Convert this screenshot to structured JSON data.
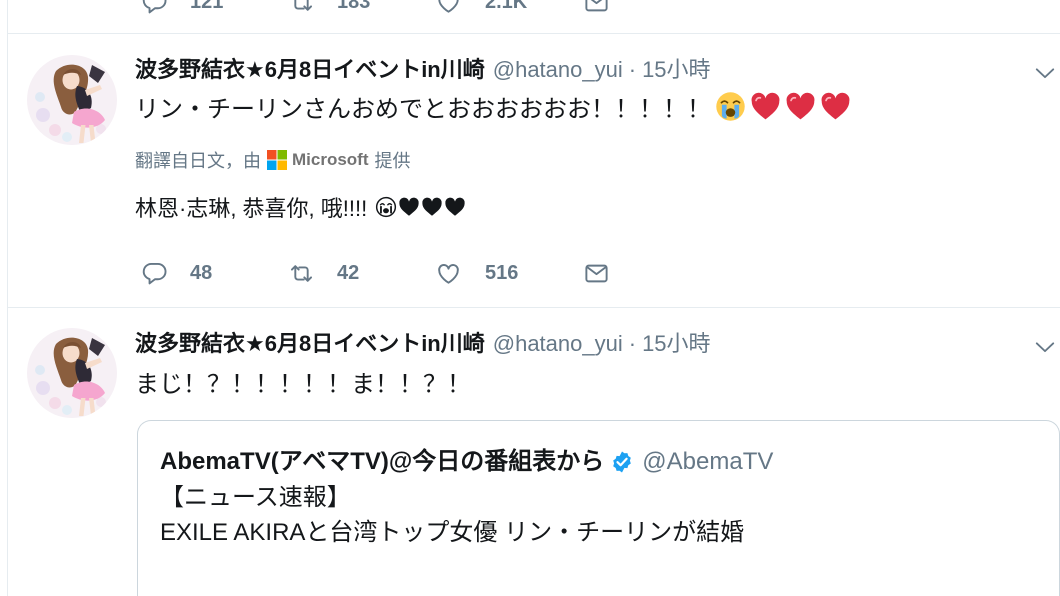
{
  "previous_tweet": {
    "actions": {
      "replies": "121",
      "retweets": "183",
      "likes": "2.1K"
    }
  },
  "tweets": [
    {
      "author": {
        "name": "波多野結衣★6月8日イベントin川崎",
        "handle": "@hatano_yui",
        "separator": "·",
        "time": "15小時"
      },
      "text": "リン・チーリンさんおめでとおおおおおお！！！！！",
      "text_emoji": [
        "loudly-crying-face",
        "red-heart",
        "red-heart",
        "red-heart"
      ],
      "translation": {
        "label_prefix": "翻譯自日文，由",
        "provider": "Microsoft",
        "label_suffix": "提供",
        "text": "林恩·志琳, 恭喜你, 哦!!!!",
        "text_emoji": [
          "loudly-crying-face",
          "black-heart",
          "black-heart",
          "black-heart"
        ]
      },
      "actions": {
        "replies": "48",
        "retweets": "42",
        "likes": "516"
      }
    },
    {
      "author": {
        "name": "波多野結衣★6月8日イベントin川崎",
        "handle": "@hatano_yui",
        "separator": "·",
        "time": "15小時"
      },
      "text": "まじ！？！！！！！ま！！？！",
      "quoted_tweet": {
        "name": "AbemaTV(アベマTV)@今日の番組表から",
        "verified": true,
        "handle": "@AbemaTV",
        "lines": [
          "【ニュース速報】",
          "EXILE AKIRAと台湾トップ女優 リン・チーリンが結婚"
        ]
      }
    }
  ],
  "icons": {
    "reply": "reply-icon",
    "retweet": "retweet-icon",
    "like": "heart-icon",
    "message": "envelope-icon",
    "menu": "chevron-down-icon",
    "verified": "verified-badge-icon"
  },
  "colors": {
    "text": "#14171a",
    "muted": "#657786",
    "divider": "#e6ecf0",
    "accent": "#1da1f2",
    "heart_red": "#dd2e44"
  }
}
